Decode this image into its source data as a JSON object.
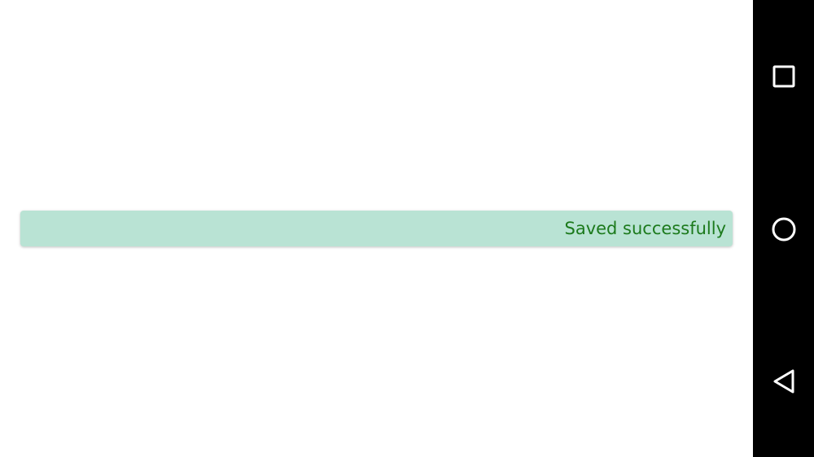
{
  "toast": {
    "message": "Saved successfully",
    "background_color": "#b9e3d4",
    "text_color": "#1c7a1c"
  },
  "navigation_bar": {
    "background_color": "#000000",
    "icon_color": "#ffffff",
    "buttons": [
      {
        "name": "recents",
        "icon": "square-icon"
      },
      {
        "name": "home",
        "icon": "circle-icon"
      },
      {
        "name": "back",
        "icon": "triangle-back-icon"
      }
    ]
  }
}
